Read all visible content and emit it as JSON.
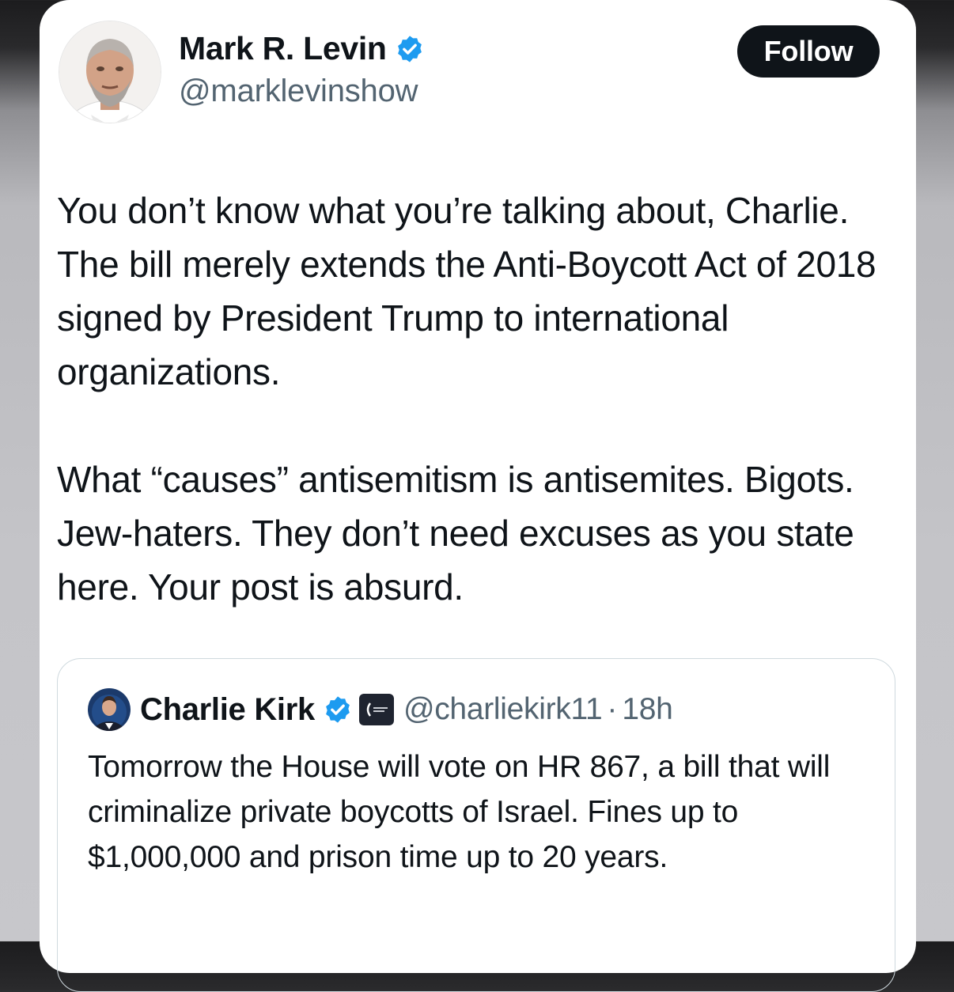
{
  "post": {
    "author": {
      "name": "Mark R. Levin",
      "handle": "@marklevinshow",
      "verified": true,
      "avatar_icon": "avatar-photo"
    },
    "follow_label": "Follow",
    "text_paragraphs": [
      "You don’t know what you’re talking about, Charlie. The bill merely extends the Anti-Boycott Act of 2018 signed by President Trump to international organizations.",
      "What “causes” antisemitism is antisemites. Bigots. Jew-haters.  They don’t need excuses as you state here.  Your post is absurd."
    ]
  },
  "quoted": {
    "author": {
      "name": "Charlie Kirk",
      "handle": "@charliekirk11",
      "verified": true,
      "affiliation_icon": "organization-badge-icon"
    },
    "separator": "·",
    "time": "18h",
    "text": "Tomorrow the House will vote on HR 867, a bill that will criminalize private boycotts of Israel. Fines up to $1,000,000 and prison time up to 20 years."
  },
  "colors": {
    "verified_blue": "#1d9bf0",
    "text_primary": "#0f1419",
    "text_secondary": "#536471",
    "button_bg": "#0f1419",
    "border": "#cfd9de"
  }
}
